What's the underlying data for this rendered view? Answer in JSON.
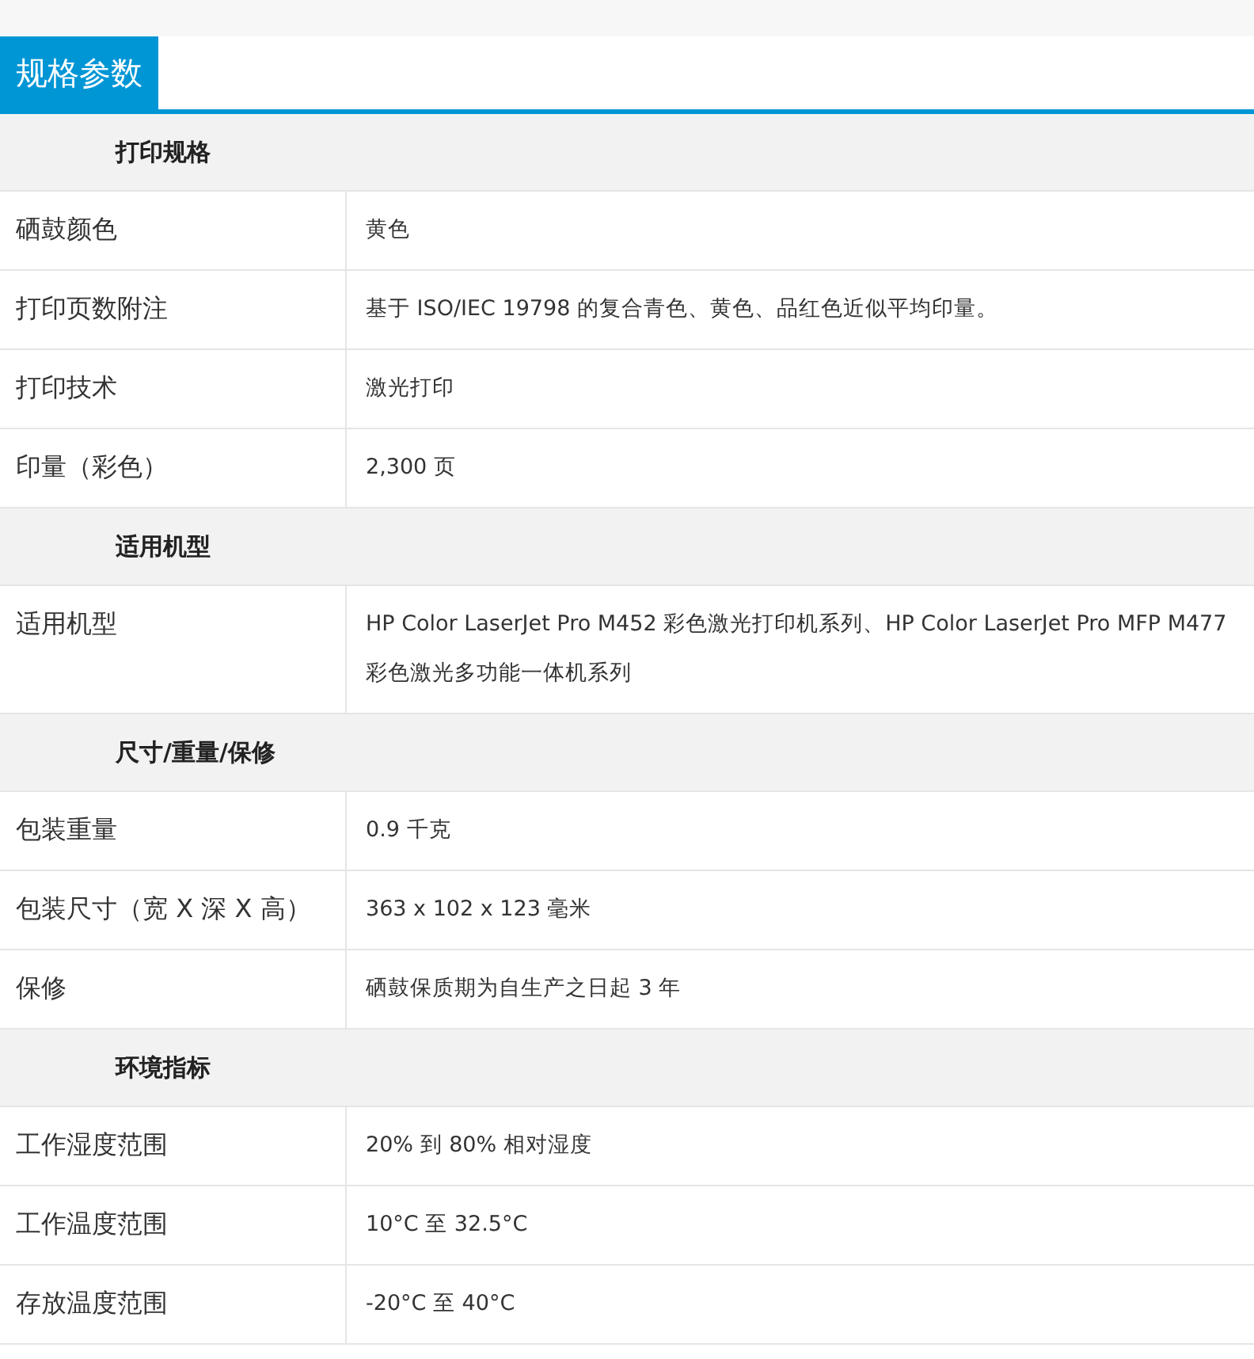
{
  "tab": {
    "label": "规格参数"
  },
  "sections": [
    {
      "title": "打印规格",
      "rows": [
        {
          "label": "硒鼓颜色",
          "value": "黄色"
        },
        {
          "label": "打印页数附注",
          "value": "基于 ISO/IEC 19798 的复合青色、黄色、品红色近似平均印量。"
        },
        {
          "label": "打印技术",
          "value": "激光打印"
        },
        {
          "label": "印量（彩色）",
          "value": "2,300 页"
        }
      ]
    },
    {
      "title": "适用机型",
      "rows": [
        {
          "label": "适用机型",
          "value": "HP Color LaserJet Pro M452 彩色激光打印机系列、HP Color LaserJet Pro MFP M477 彩色激光多功能一体机系列"
        }
      ]
    },
    {
      "title": "尺寸/重量/保修",
      "rows": [
        {
          "label": "包装重量",
          "value": "0.9 千克"
        },
        {
          "label": "包装尺寸（宽 X 深 X 高）",
          "value": "363 x 102 x 123 毫米"
        },
        {
          "label": "保修",
          "value": "硒鼓保质期为自生产之日起 3 年"
        }
      ]
    },
    {
      "title": "环境指标",
      "rows": [
        {
          "label": "工作湿度范围",
          "value": "20% 到 80% 相对湿度"
        },
        {
          "label": "工作温度范围",
          "value": "10°C 至 32.5°C"
        },
        {
          "label": "存放温度范围",
          "value": "-20°C 至 40°C"
        }
      ]
    }
  ]
}
